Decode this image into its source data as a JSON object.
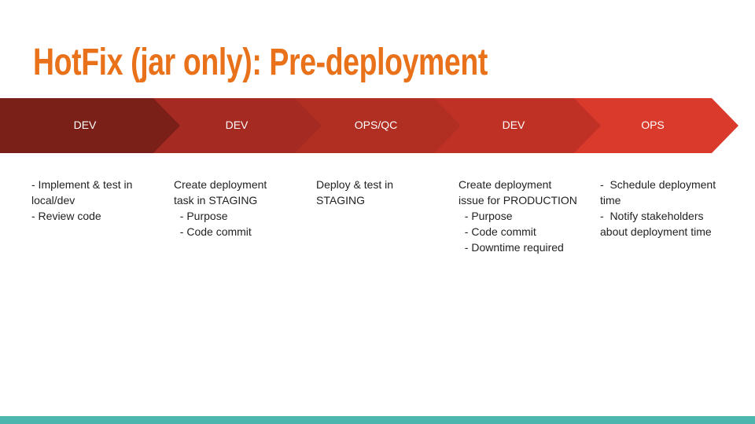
{
  "title": "HotFix (jar only): Pre-deployment",
  "stages": [
    {
      "label": "DEV",
      "color": "#7a2018",
      "lines": [
        "- Implement & test in",
        "local/dev",
        "- Review code"
      ]
    },
    {
      "label": "DEV",
      "color": "#a52a21",
      "lines": [
        "Create deployment",
        "task in STAGING",
        "  - Purpose",
        "  - Code commit"
      ]
    },
    {
      "label": "OPS/QC",
      "color": "#b12e23",
      "lines": [
        "Deploy & test in",
        "STAGING"
      ]
    },
    {
      "label": "DEV",
      "color": "#c03125",
      "lines": [
        "Create deployment",
        "issue for PRODUCTION",
        "  - Purpose",
        "  - Code commit",
        "  - Downtime required"
      ]
    },
    {
      "label": "OPS",
      "color": "#d93a2c",
      "lines": [
        "-  Schedule deployment",
        "time",
        "-  Notify stakeholders",
        "about deployment time"
      ]
    }
  ],
  "colors": {
    "title": "#e8711a",
    "footer_bar": "#4db6ac"
  }
}
